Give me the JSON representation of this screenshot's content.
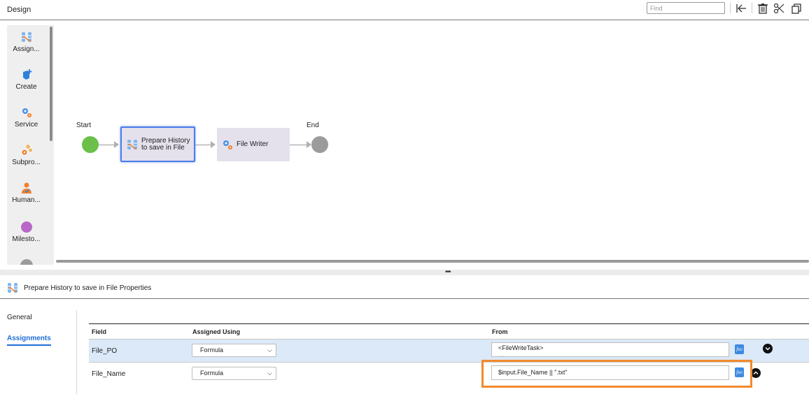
{
  "header": {
    "title": "Design",
    "find_placeholder": "Find",
    "toolbar": [
      {
        "name": "collapse-left-icon"
      },
      {
        "name": "trash-icon"
      },
      {
        "name": "scissors-icon"
      },
      {
        "name": "copy-icon"
      }
    ]
  },
  "palette": {
    "items": [
      {
        "label": "Assign...",
        "icon": "assignment-icon"
      },
      {
        "label": "Create",
        "icon": "create-icon"
      },
      {
        "label": "Service",
        "icon": "service-icon"
      },
      {
        "label": "Subpro...",
        "icon": "subprocess-icon"
      },
      {
        "label": "Human...",
        "icon": "human-task-icon"
      },
      {
        "label": "Milesto...",
        "icon": "milestone-icon"
      }
    ]
  },
  "canvas": {
    "start_label": "Start",
    "end_label": "End",
    "nodes": [
      {
        "line1": "Prepare History",
        "line2": "to save in File",
        "icon": "assignment-icon",
        "selected": true
      },
      {
        "line1": "File Writer",
        "icon": "service-icon",
        "selected": false
      }
    ],
    "colors": {
      "start": "#6cc04a",
      "end": "#9b9b9b",
      "node_bg": "#e4e0ec",
      "selected_border": "#4a7ce8"
    }
  },
  "splitter": {
    "dots": "•••"
  },
  "properties": {
    "title": "Prepare History to save in File Properties",
    "nav": {
      "general": "General",
      "assignments": "Assignments",
      "active": "Assignments"
    },
    "grid": {
      "columns": [
        "Field",
        "Assigned Using",
        "From"
      ],
      "rows": [
        {
          "field": "File_PO",
          "assigned_using": "Formula",
          "from": "<FileWriteTask>",
          "from_overflow": "...",
          "expanded": false,
          "selected": true
        },
        {
          "field": "File_Name",
          "assigned_using": "Formula",
          "from": "$input.File_Name || \".txt\"",
          "expanded": true,
          "selected": false,
          "highlighted": true
        }
      ],
      "fx_label": "fxo",
      "highlight_color": "#f28a2e",
      "accent_color": "#1d6fd6"
    }
  }
}
